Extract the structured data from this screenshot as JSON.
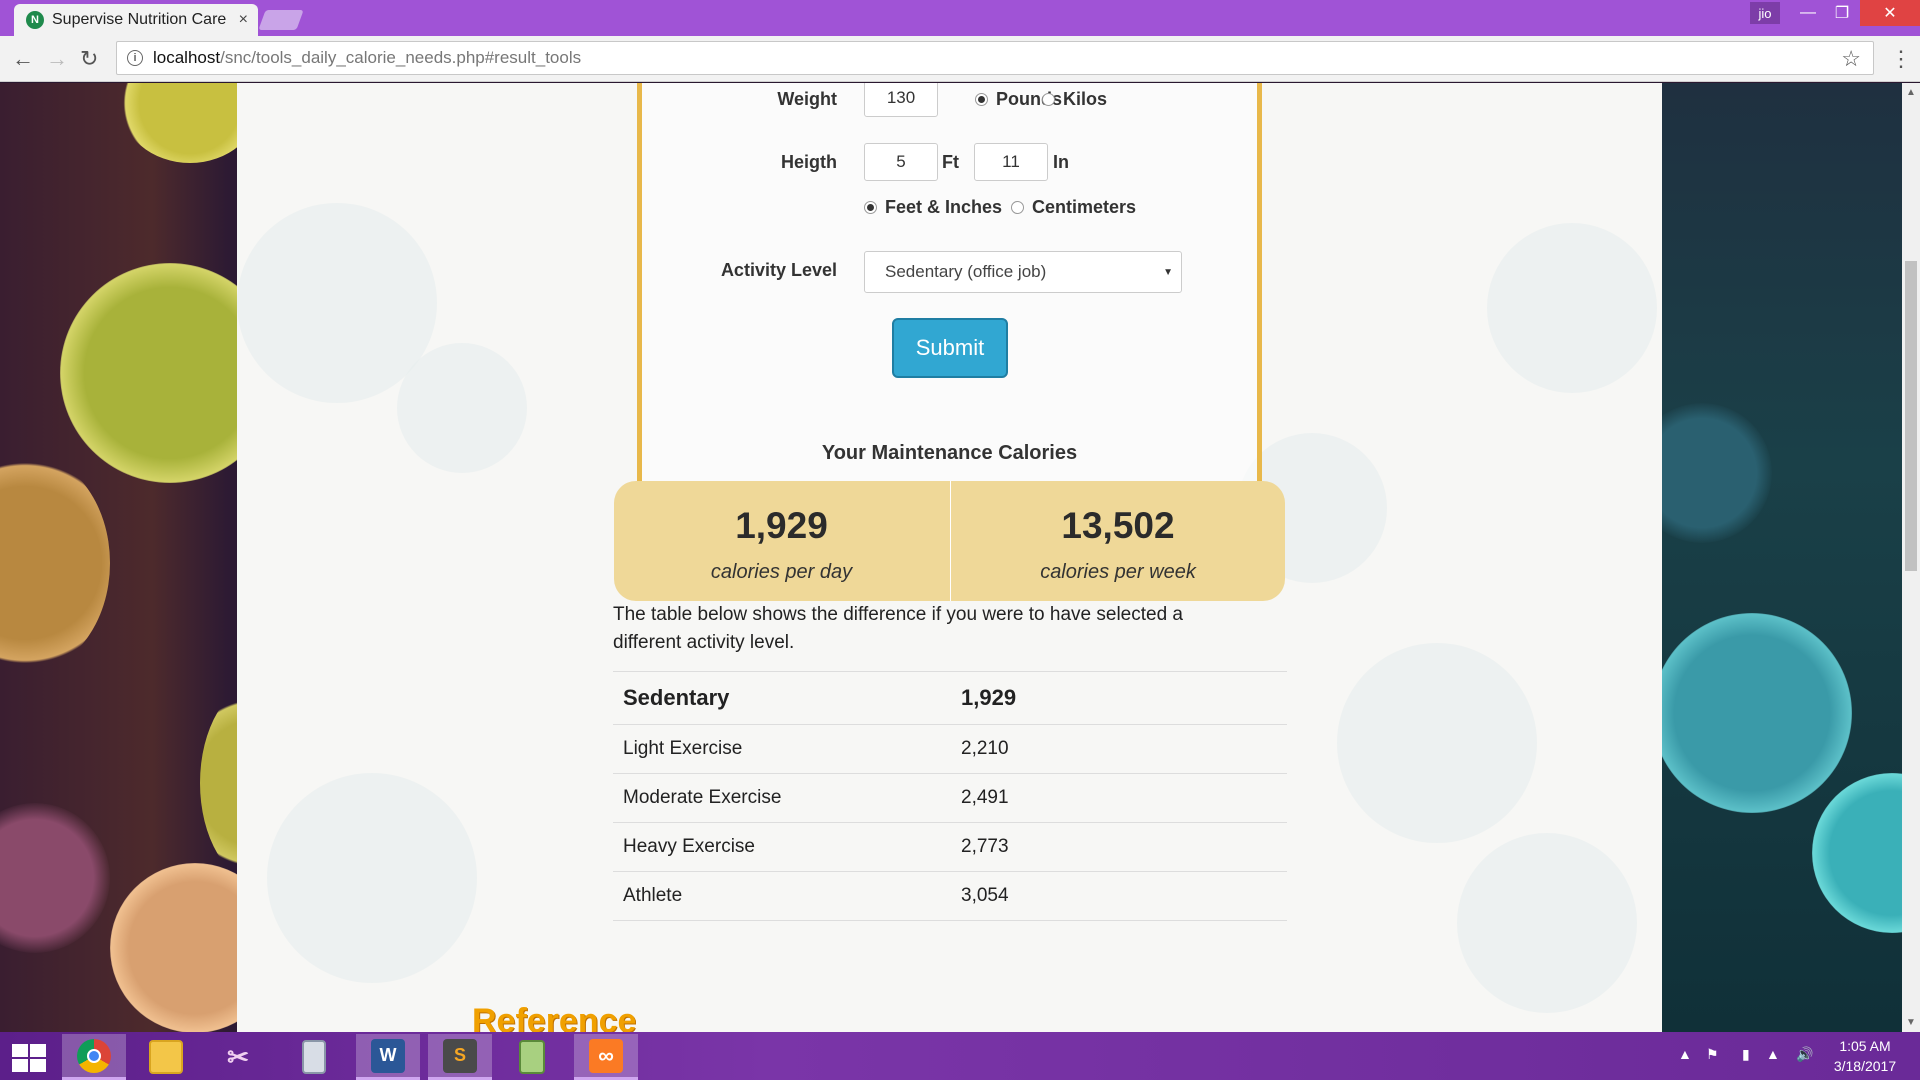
{
  "browser": {
    "tab_title": "Supervise Nutrition Care",
    "tab_close": "×",
    "profile": "jio",
    "url_host": "localhost",
    "url_path": "/snc/tools_daily_calorie_needs.php#result_tools"
  },
  "form": {
    "weight_label": "Weight",
    "weight_value": "130",
    "unit_pounds": "Pounds",
    "unit_kilos": "Kilos",
    "weight_unit_selected": "Pounds",
    "height_label": "Heigth",
    "height_ft_value": "5",
    "height_ft_unit": "Ft",
    "height_in_value": "11",
    "height_in_unit": "In",
    "height_mode_feet": "Feet & Inches",
    "height_mode_cm": "Centimeters",
    "height_mode_selected": "Feet & Inches",
    "activity_label": "Activity Level",
    "activity_selected": "Sedentary (office job)",
    "submit_label": "Submit"
  },
  "results": {
    "title": "Your Maintenance Calories",
    "per_day_value": "1,929",
    "per_day_label": "calories per day",
    "per_week_value": "13,502",
    "per_week_label": "calories per week",
    "explanation": "The table below shows the difference if you were to have selected a different activity level.",
    "rows": [
      {
        "level": "Sedentary",
        "calories": "1,929"
      },
      {
        "level": "Light Exercise",
        "calories": "2,210"
      },
      {
        "level": "Moderate Exercise",
        "calories": "2,491"
      },
      {
        "level": "Heavy Exercise",
        "calories": "2,773"
      },
      {
        "level": "Athlete",
        "calories": "3,054"
      }
    ]
  },
  "reference_heading": "Reference",
  "taskbar": {
    "apps": [
      "windows-start-icon",
      "chrome-icon",
      "file-explorer-icon",
      "snipping-tool-icon",
      "calculator-icon",
      "word-icon",
      "sublime-text-icon",
      "notepad-icon",
      "xampp-icon"
    ],
    "time": "1:05 AM",
    "date": "3/18/2017"
  },
  "colors": {
    "titlebar": "#a053d6",
    "form_border": "#e8b84a",
    "submit": "#31a7d2",
    "calorie_box": "#efd898",
    "reference_text": "#f0a000"
  }
}
